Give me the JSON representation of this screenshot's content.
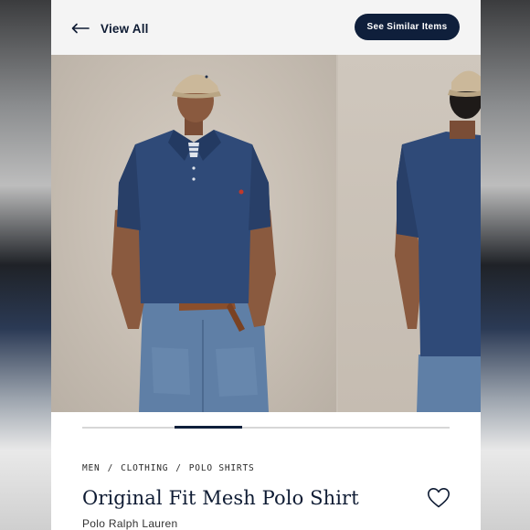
{
  "header": {
    "back_label": "View All",
    "similar_label": "See Similar Items"
  },
  "gallery": {
    "image_count": 5,
    "current_index": 2,
    "progress_fraction_start": 0.25,
    "progress_fraction_end": 0.435
  },
  "product": {
    "breadcrumb": [
      "MEN",
      "CLOTHING",
      "POLO SHIRTS"
    ],
    "breadcrumb_separator": "/",
    "title": "Original Fit Mesh Polo Shirt",
    "brand": "Polo Ralph Lauren"
  },
  "colors": {
    "navy": "#0f1f3b",
    "shirt": "#2f4a78",
    "background": "#c8c0b6"
  },
  "icons": {
    "back": "arrow-left-icon",
    "favorite": "heart-icon"
  }
}
